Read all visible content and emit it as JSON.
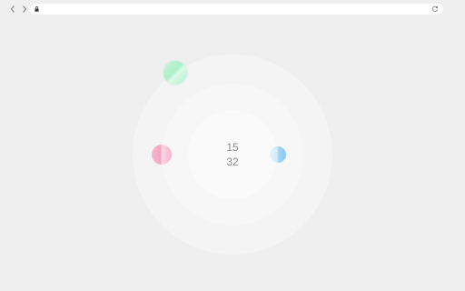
{
  "browser": {
    "back_icon": "chevron-left-icon",
    "forward_icon": "chevron-right-icon",
    "lock_icon": "lock-icon",
    "reload_icon": "reload-icon",
    "url": ""
  },
  "readout": {
    "top_value": "15",
    "bottom_value": "32"
  },
  "colors": {
    "background": "#efefef",
    "green_orb": "#aaf0c8",
    "pink_orb": "#f4a6c2",
    "blue_orb": "#8ccbf0"
  }
}
